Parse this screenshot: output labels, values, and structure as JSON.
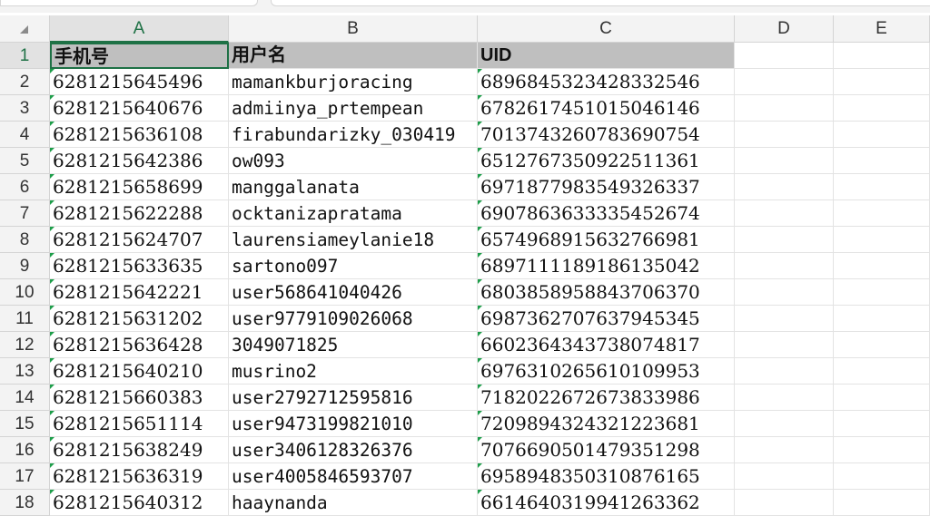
{
  "columns": [
    "A",
    "B",
    "C",
    "D",
    "E"
  ],
  "header_row": {
    "num": "1",
    "a": "手机号",
    "b": "用户名",
    "c": "UID"
  },
  "rows": [
    {
      "num": "2",
      "a": "6281215645496",
      "b": "mamankburjoracing",
      "c": "6896845323428332546"
    },
    {
      "num": "3",
      "a": "6281215640676",
      "b": "admiinya_prtempean",
      "c": "6782617451015046146"
    },
    {
      "num": "4",
      "a": "6281215636108",
      "b": "firabundarizky_030419",
      "c": "7013743260783690754"
    },
    {
      "num": "5",
      "a": "6281215642386",
      "b": "ow093",
      "c": "6512767350922511361"
    },
    {
      "num": "6",
      "a": "6281215658699",
      "b": "manggalanata",
      "c": "6971877983549326337"
    },
    {
      "num": "7",
      "a": "6281215622288",
      "b": "ocktanizapratama",
      "c": "6907863633335452674"
    },
    {
      "num": "8",
      "a": "6281215624707",
      "b": "laurensiameylanie18",
      "c": "6574968915632766981"
    },
    {
      "num": "9",
      "a": "6281215633635",
      "b": "sartono097",
      "c": "6897111189186135042"
    },
    {
      "num": "10",
      "a": "6281215642221",
      "b": "user568641040426",
      "c": "6803858958843706370"
    },
    {
      "num": "11",
      "a": "6281215631202",
      "b": "user9779109026068",
      "c": "6987362707637945345"
    },
    {
      "num": "12",
      "a": "6281215636428",
      "b": "3049071825",
      "c": "6602364343738074817"
    },
    {
      "num": "13",
      "a": "6281215640210",
      "b": "musrino2",
      "c": "6976310265610109953"
    },
    {
      "num": "14",
      "a": "6281215660383",
      "b": "user2792712595816",
      "c": "7182022672673833986"
    },
    {
      "num": "15",
      "a": "6281215651114",
      "b": "user9473199821010",
      "c": "7209894324321223681"
    },
    {
      "num": "16",
      "a": "6281215638249",
      "b": "user3406128326376",
      "c": "7076690501479351298"
    },
    {
      "num": "17",
      "a": "6281215636319",
      "b": "user4005846593707",
      "c": "6958948350310876165"
    },
    {
      "num": "18",
      "a": "6281215640312",
      "b": "haaynanda",
      "c": "6614640319941263362"
    }
  ],
  "colors": {
    "accent": "#1e7145",
    "header_fill": "#bfbfbf",
    "flag": "#1e9e4a"
  }
}
